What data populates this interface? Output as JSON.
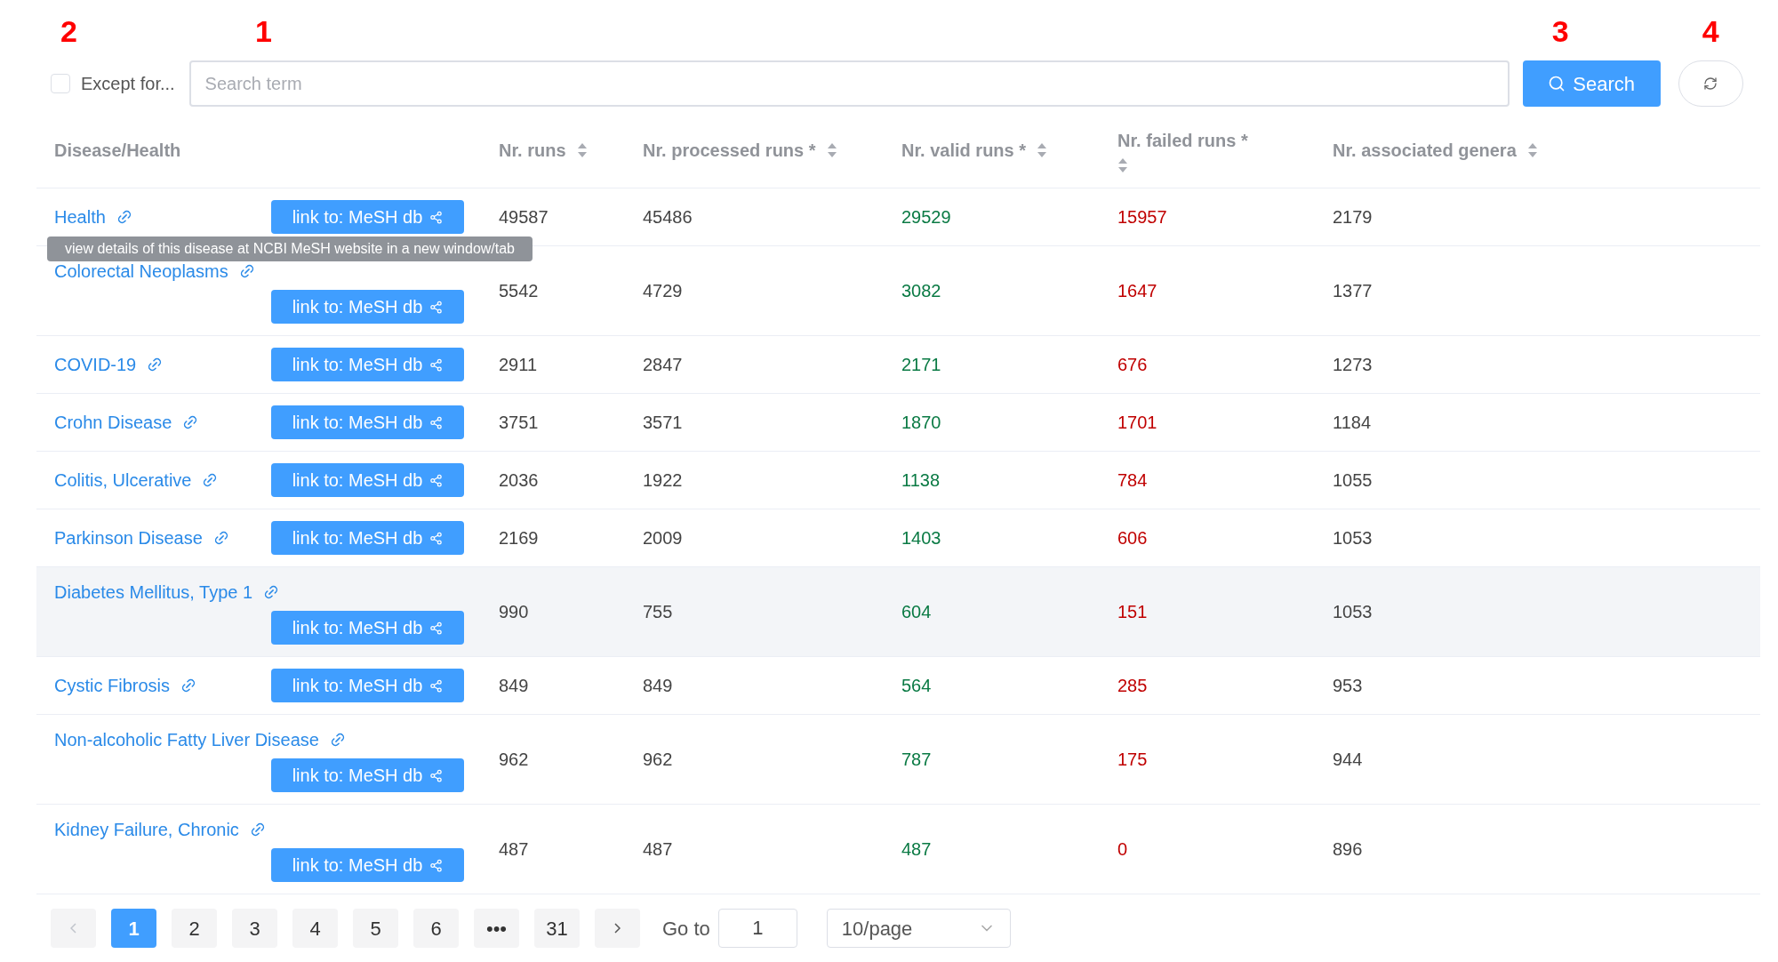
{
  "annotations": [
    "2",
    "1",
    "3",
    "4"
  ],
  "filter": {
    "checkbox": {
      "label": "Except for...",
      "checked": false
    },
    "search": {
      "placeholder": "Search term"
    },
    "search_button": "Search"
  },
  "table": {
    "columns": [
      {
        "label": "Disease/Health",
        "sortable": false
      },
      {
        "label": "Nr. runs",
        "sortable": true
      },
      {
        "label": "Nr. processed runs *",
        "sortable": true
      },
      {
        "label": "Nr. valid runs *",
        "sortable": true
      },
      {
        "label": "Nr. failed runs *",
        "sortable": true
      },
      {
        "label": "Nr. associated genera",
        "sortable": true
      }
    ],
    "rows": [
      {
        "name": "Health",
        "button": "link to: MeSH db",
        "runs": "49587",
        "processed": "45486",
        "valid": "29529",
        "failed": "15957",
        "genera": "2179",
        "highlighted": false
      },
      {
        "name": "Colorectal Neoplasms",
        "button": "link to: MeSH db",
        "runs": "5542",
        "processed": "4729",
        "valid": "3082",
        "failed": "1647",
        "genera": "1377",
        "highlighted": false
      },
      {
        "name": "COVID-19",
        "button": "link to: MeSH db",
        "runs": "2911",
        "processed": "2847",
        "valid": "2171",
        "failed": "676",
        "genera": "1273",
        "highlighted": false
      },
      {
        "name": "Crohn Disease",
        "button": "link to: MeSH db",
        "runs": "3751",
        "processed": "3571",
        "valid": "1870",
        "failed": "1701",
        "genera": "1184",
        "highlighted": false
      },
      {
        "name": "Colitis, Ulcerative",
        "button": "link to: MeSH db",
        "runs": "2036",
        "processed": "1922",
        "valid": "1138",
        "failed": "784",
        "genera": "1055",
        "highlighted": false
      },
      {
        "name": "Parkinson Disease",
        "button": "link to: MeSH db",
        "runs": "2169",
        "processed": "2009",
        "valid": "1403",
        "failed": "606",
        "genera": "1053",
        "highlighted": false
      },
      {
        "name": "Diabetes Mellitus, Type 1",
        "button": "link to: MeSH db",
        "runs": "990",
        "processed": "755",
        "valid": "604",
        "failed": "151",
        "genera": "1053",
        "highlighted": true
      },
      {
        "name": "Cystic Fibrosis",
        "button": "link to: MeSH db",
        "runs": "849",
        "processed": "849",
        "valid": "564",
        "failed": "285",
        "genera": "953",
        "highlighted": false
      },
      {
        "name": "Non-alcoholic Fatty Liver Disease",
        "button": "link to: MeSH db",
        "runs": "962",
        "processed": "962",
        "valid": "787",
        "failed": "175",
        "genera": "944",
        "highlighted": false
      },
      {
        "name": "Kidney Failure, Chronic",
        "button": "link to: MeSH db",
        "runs": "487",
        "processed": "487",
        "valid": "487",
        "failed": "0",
        "genera": "896",
        "highlighted": false
      }
    ]
  },
  "tooltip": "view details of this disease at NCBI MeSH website in a new window/tab",
  "pagination": {
    "prev_disabled": true,
    "pages": [
      {
        "label": "1",
        "selected": true
      },
      {
        "label": "2",
        "selected": false
      },
      {
        "label": "3",
        "selected": false
      },
      {
        "label": "4",
        "selected": false
      },
      {
        "label": "5",
        "selected": false
      },
      {
        "label": "6",
        "selected": false
      },
      {
        "label": "•••",
        "selected": false
      },
      {
        "label": "31",
        "selected": false
      }
    ],
    "goto_label": "Go to",
    "goto_value": "1",
    "page_size": "10/page"
  }
}
